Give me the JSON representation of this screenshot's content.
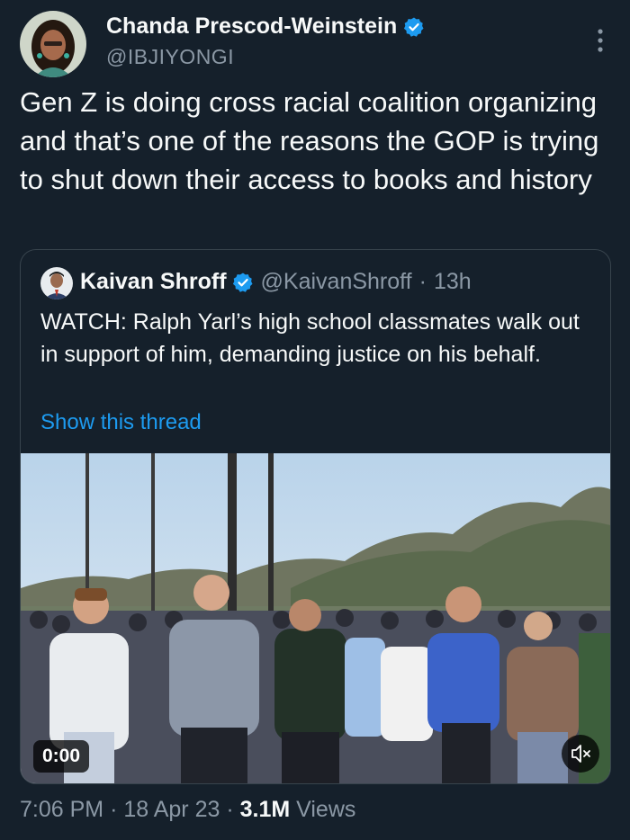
{
  "colors": {
    "background": "#15202b",
    "text": "#f7f9f9",
    "muted": "#8b98a5",
    "link": "#1d9bf0",
    "verified": "#1d9bf0"
  },
  "tweet": {
    "author_name": "Chanda Prescod-Weinstein",
    "author_handle": "@IBJIYONGI",
    "verified_icon": "verified-badge-icon",
    "text": "Gen Z is doing cross racial coalition organizing and that’s one of the reasons the GOP is trying to shut down their access to books and history",
    "time": "7:06 PM",
    "date": "18 Apr 23",
    "views_count": "3.1M",
    "views_label": "Views",
    "separator": "·"
  },
  "quote": {
    "author_name": "Kaivan Shroff",
    "author_handle": "@KaivanShroff",
    "age": "13h",
    "separator": "·",
    "text": "WATCH: Ralph Yarl’s high school classmates walk out in support of him, demanding justice on his behalf.",
    "show_thread": "Show this thread",
    "video": {
      "timecode": "0:00",
      "mute_icon": "speaker-muted-icon"
    }
  }
}
